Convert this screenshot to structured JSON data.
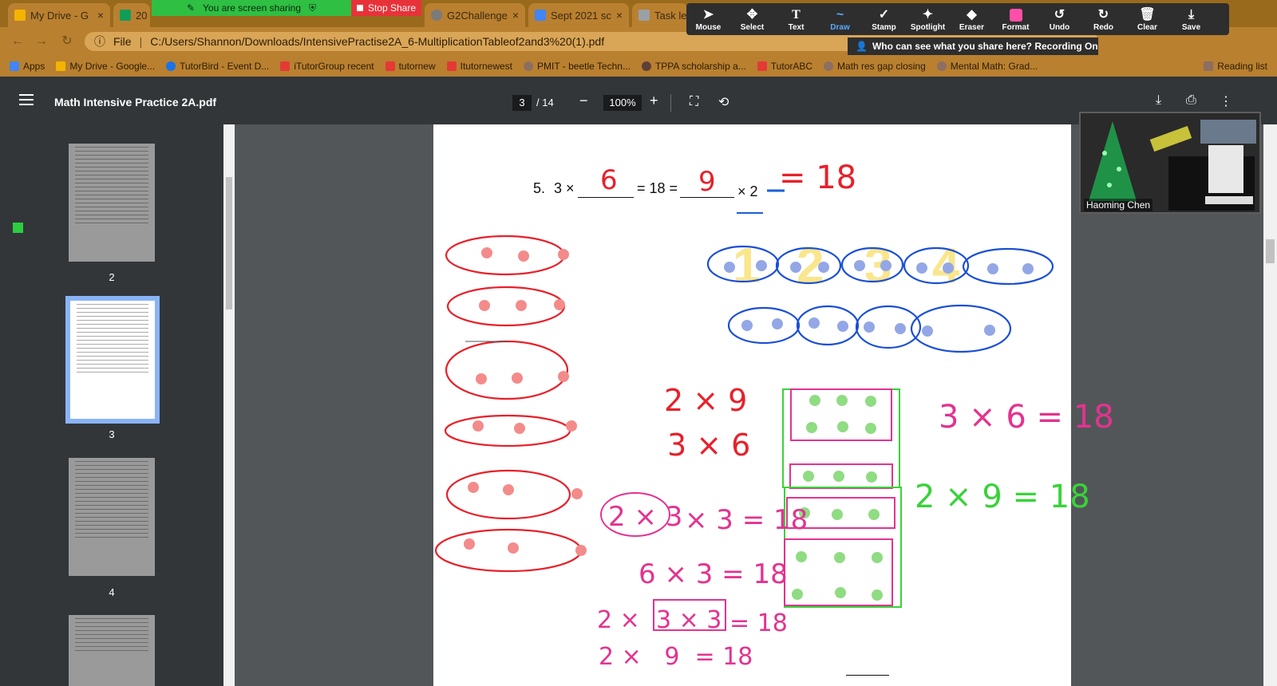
{
  "tabs": [
    {
      "label": "My Drive - G",
      "color": "#f4b400"
    },
    {
      "label": "20",
      "color": "#0f9d58"
    },
    {
      "label": "G2Challenge",
      "color": "#7a7a7a"
    },
    {
      "label": "Sept 2021 sc",
      "color": "#4285f4"
    },
    {
      "label": "Task lea",
      "color": "#9aa0a6"
    }
  ],
  "share": {
    "banner": "You are screen sharing",
    "stop": "Stop Share"
  },
  "annotate": {
    "tools": [
      "Mouse",
      "Select",
      "Text",
      "Draw",
      "Stamp",
      "Spotlight",
      "Eraser",
      "Format",
      "Undo",
      "Redo",
      "Clear",
      "Save"
    ],
    "active": "Draw",
    "format_color": "#ff4fa8",
    "recording_notice": "Who can see what you share here? Recording On"
  },
  "address": {
    "scheme": "File",
    "url": "C:/Users/Shannon/Downloads/IntensivePractise2A_6-MultiplicationTableof2and3%20(1).pdf"
  },
  "bookmarks": [
    {
      "label": "Apps",
      "color": "#4285f4"
    },
    {
      "label": "My Drive - Google...",
      "color": "#f4b400"
    },
    {
      "label": "TutorBird - Event D...",
      "color": "#1a73e8"
    },
    {
      "label": "iTutorGroup recent",
      "color": "#e53935"
    },
    {
      "label": "tutornew",
      "color": "#e53935"
    },
    {
      "label": "Itutornewest",
      "color": "#e53935"
    },
    {
      "label": "PMIT - beetle Techn...",
      "color": "#8d6e63"
    },
    {
      "label": "TPPA scholarship a...",
      "color": "#5d4037"
    },
    {
      "label": "TutorABC",
      "color": "#e53935"
    },
    {
      "label": "Math res gap closing",
      "color": "#8d6e63"
    },
    {
      "label": "Mental Math: Grad...",
      "color": "#8d6e63"
    },
    {
      "label": "Reading list",
      "color": "#8d6e63"
    }
  ],
  "pdf": {
    "title": "Math Intensive Practice 2A.pdf",
    "page_current": "3",
    "page_total": "/ 14",
    "zoom": "100%",
    "thumbnails": [
      {
        "number": "2",
        "selected": false
      },
      {
        "number": "3",
        "selected": true
      },
      {
        "number": "4",
        "selected": false
      }
    ]
  },
  "document": {
    "question_number": "5.",
    "q_part1": "3 ×",
    "q_part2": "= 18 =",
    "q_part3": "× 2",
    "hw": {
      "blank1": "6",
      "blank2": "9",
      "eq18": "= 18",
      "red_2x9": "2 × 9",
      "red_3x6": "3 × 6",
      "pink_a": "2 × 3",
      "pink_a_rest": "× 3 = 18",
      "pink_b": "6  × 3 = 18",
      "pink_c_lead": "2 ×",
      "pink_c_box": "3 × 3",
      "pink_c_rest": "= 18",
      "pink_d": "2 ×   9  = 18",
      "pink_3x6": "3 × 6 = 18",
      "green_2x9": "2 × 9 = 18",
      "yellow_nums": [
        "1",
        "2",
        "3",
        "4"
      ]
    }
  },
  "video": {
    "name": "Haoming Chen"
  }
}
